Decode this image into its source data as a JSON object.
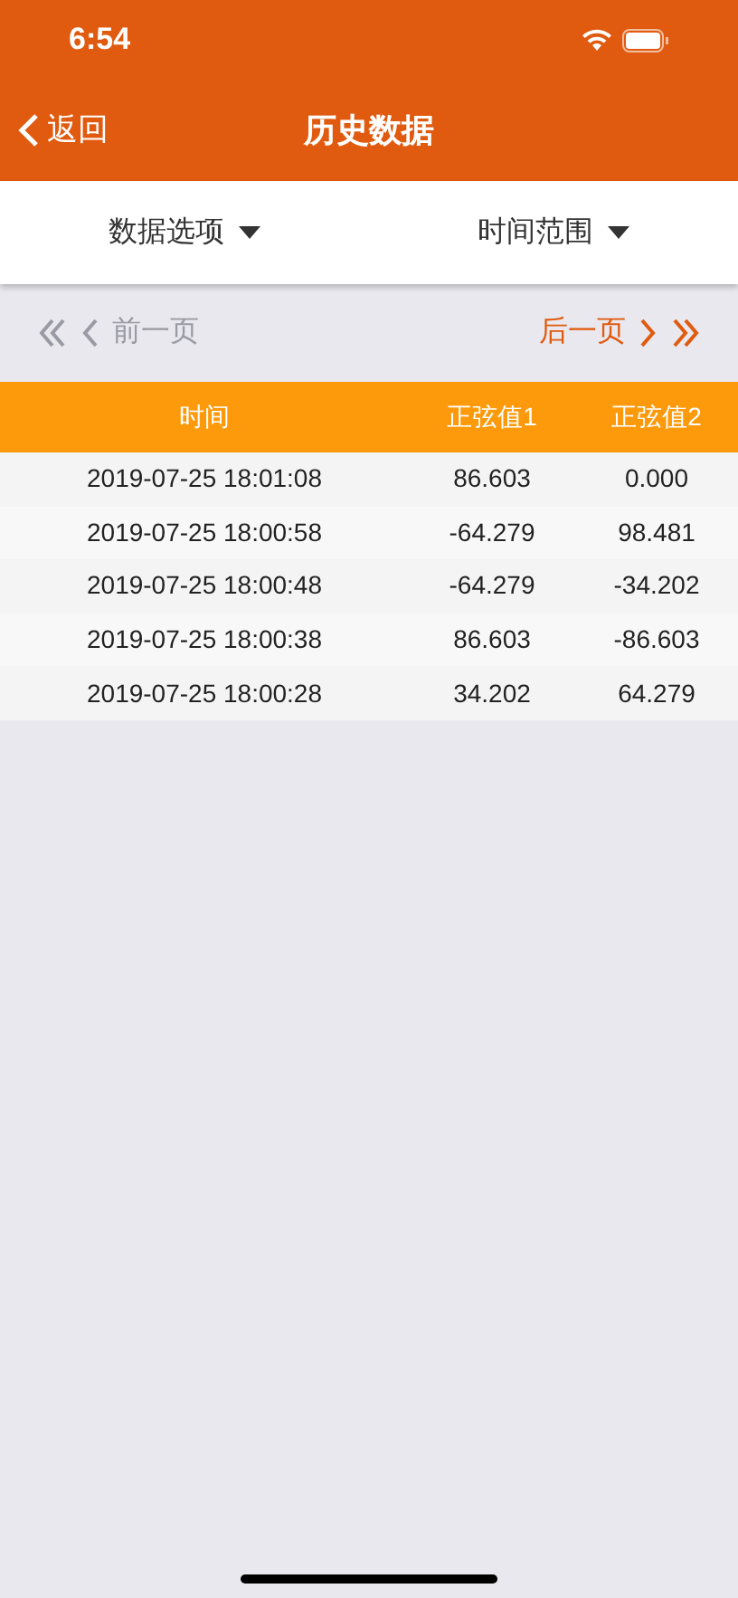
{
  "status_bar": {
    "time": "6:54"
  },
  "nav": {
    "back": "返回",
    "title": "历史数据"
  },
  "filters": [
    {
      "label": "数据选项"
    },
    {
      "label": "时间范围"
    }
  ],
  "pager": {
    "prev": {
      "label": "前一页",
      "disabled": true
    },
    "next": {
      "label": "后一页",
      "disabled": false
    }
  },
  "table": {
    "columns": [
      "时间",
      "正弦值1",
      "正弦值2"
    ],
    "rows": [
      [
        "2019-07-25 18:01:08",
        "86.603",
        "0.000"
      ],
      [
        "2019-07-25 18:00:58",
        "-64.279",
        "98.481"
      ],
      [
        "2019-07-25 18:00:48",
        "-64.279",
        "-34.202"
      ],
      [
        "2019-07-25 18:00:38",
        "86.603",
        "-86.603"
      ],
      [
        "2019-07-25 18:00:28",
        "34.202",
        "64.279"
      ]
    ]
  }
}
